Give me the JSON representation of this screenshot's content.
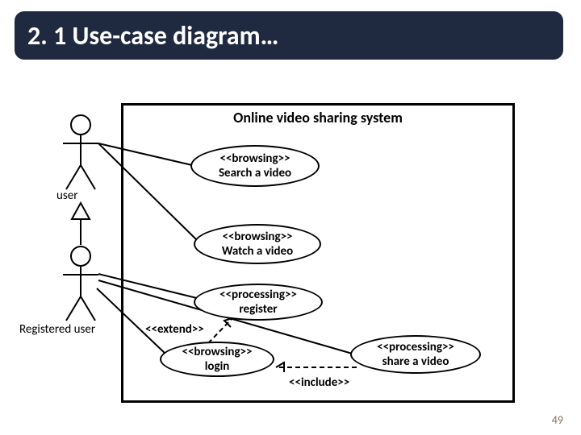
{
  "title": "2. 1 Use-case diagram…",
  "system": "Online video sharing system",
  "actors": {
    "user": "user",
    "registered": "Registered user"
  },
  "usecases": {
    "search": {
      "stereo": "<<browsing>>",
      "name": "Search a video"
    },
    "watch": {
      "stereo": "<<browsing>>",
      "name": "Watch a video"
    },
    "register": {
      "stereo": "<<processing>>",
      "name": "register"
    },
    "login": {
      "stereo": "<<browsing>>",
      "name": "login"
    },
    "share": {
      "stereo": "<<processing>>",
      "name": "share a video"
    }
  },
  "relations": {
    "extend": "<<extend>>",
    "include": "<<include>>"
  },
  "page": "49"
}
